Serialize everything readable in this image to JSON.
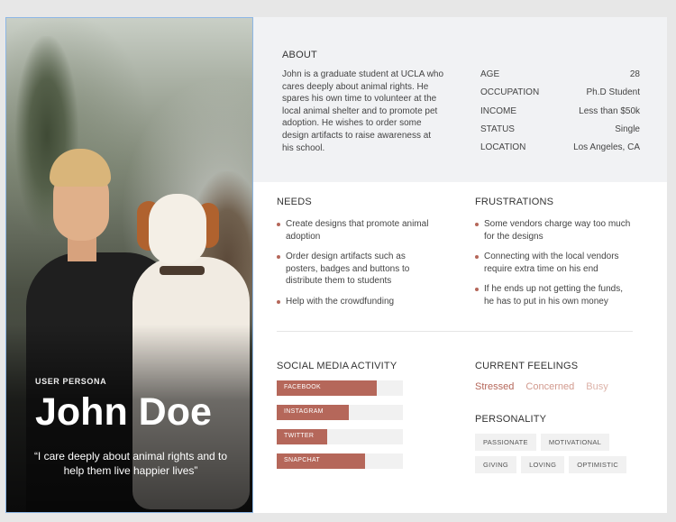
{
  "persona": {
    "label": "USER PERSONA",
    "name": "John Doe",
    "quote": "“I care deeply about animal rights and to help them live happier lives”"
  },
  "about": {
    "heading": "ABOUT",
    "text": "John is a graduate student at UCLA who cares deeply about animal rights. He spares his own time to volunteer at the local animal shelter and to promote pet adoption. He wishes to order some design artifacts to raise awareness at his school."
  },
  "stats": [
    {
      "label": "AGE",
      "value": "28"
    },
    {
      "label": "OCCUPATION",
      "value": "Ph.D Student"
    },
    {
      "label": "INCOME",
      "value": "Less than $50k"
    },
    {
      "label": "STATUS",
      "value": "Single"
    },
    {
      "label": "LOCATION",
      "value": "Los Angeles, CA"
    }
  ],
  "needs": {
    "heading": "NEEDS",
    "items": [
      "Create designs that promote animal adoption",
      "Order design artifacts such as posters, badges and buttons to distribute them to students",
      "Help with the crowdfunding"
    ]
  },
  "frustrations": {
    "heading": "FRUSTRATIONS",
    "items": [
      "Some vendors charge way too much for the designs",
      "Connecting with the local vendors require extra time on his end",
      "If he ends up not getting the funds, he has to put in his own money"
    ]
  },
  "social": {
    "heading": "SOCIAL MEDIA ACTIVITY",
    "bars": [
      {
        "label": "FACEBOOK",
        "level": 0.79
      },
      {
        "label": "INSTAGRAM",
        "level": 0.57
      },
      {
        "label": "TWITTER",
        "level": 0.4
      },
      {
        "label": "SNAPCHAT",
        "level": 0.7
      }
    ]
  },
  "feelings": {
    "heading": "CURRENT FEELINGS",
    "items": [
      {
        "label": "Stressed",
        "color": "#b5675a"
      },
      {
        "label": "Concerned",
        "color": "#d29a8e"
      },
      {
        "label": "Busy",
        "color": "#dcb2a8"
      }
    ]
  },
  "personality": {
    "heading": "PERSONALITY",
    "tags": [
      "PASSIONATE",
      "MOTIVATIONAL",
      "GIVING",
      "LOVING",
      "OPTIMISTIC"
    ]
  },
  "colors": {
    "accent": "#b5675a",
    "panel": "#f1f2f4"
  }
}
